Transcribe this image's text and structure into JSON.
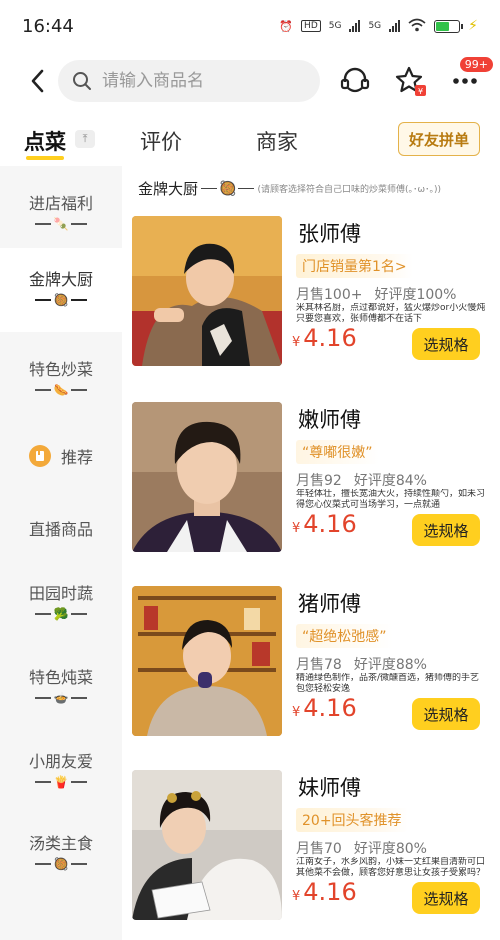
{
  "status_bar": {
    "time": "16:44",
    "hd": "HD",
    "net1": "5G",
    "net2": "5G"
  },
  "nav": {
    "search_placeholder": "请输入商品名",
    "more_badge": "99+"
  },
  "tabs": [
    {
      "label": "点菜",
      "active": true
    },
    {
      "label": "评价",
      "active": false
    },
    {
      "label": "商家",
      "active": false
    }
  ],
  "group_order_label": "好友拼单",
  "sidebar": [
    {
      "label": "进店福利",
      "deco": "🍡",
      "active": false
    },
    {
      "label": "金牌大厨",
      "deco": "🥘",
      "active": true
    },
    {
      "label": "特色炒菜",
      "deco": "🌭",
      "active": false
    },
    {
      "label": "推荐",
      "deco": "",
      "active": false
    },
    {
      "label": "直播商品",
      "deco": "",
      "active": false
    },
    {
      "label": "田园时蔬",
      "deco": "🥦",
      "active": false
    },
    {
      "label": "特色炖菜",
      "deco": "🍲",
      "active": false
    },
    {
      "label": "小朋友爱",
      "deco": "🍟",
      "active": false
    },
    {
      "label": "汤类主食",
      "deco": "🥘",
      "active": false
    }
  ],
  "section": {
    "title": "金牌大厨",
    "note": "(请顾客选择符合自己口味的炒菜师傅(｡･ω･｡))"
  },
  "chefs": [
    {
      "name": "张师傅",
      "tag": "门店销量第1名>",
      "sales": "月售100+",
      "rating": "好评度100%",
      "desc": "米其林名厨，点过都说好，猛火爆炒or小火慢炖只要您喜欢，张师傅都不在话下",
      "currency": "¥",
      "price": "4.16",
      "button": "选规格"
    },
    {
      "name": "嫩师傅",
      "tag": "“尊嘟很嫩”",
      "sales": "月售92",
      "rating": "好评度84%",
      "desc": "年轻体壮，擅长宽油大火，持续性颠勺，如未习得您心仪菜式可当场学习，一点就通",
      "currency": "¥",
      "price": "4.16",
      "button": "选规格"
    },
    {
      "name": "猪师傅",
      "tag": "“超绝松弛感”",
      "sales": "月售78",
      "rating": "好评度88%",
      "desc": "精通绿色制作，品茶/微醺首选，猪师傅的手艺包您轻松安逸",
      "currency": "¥",
      "price": "4.16",
      "button": "选规格"
    },
    {
      "name": "妹师傅",
      "tag": "20+回头客推荐",
      "sales": "月售70",
      "rating": "好评度80%",
      "desc": "江南女子，水乡风韵，小妹一丈红果自清新可口其他菜不会做，顾客您好意思让女孩子受累吗？",
      "currency": "¥",
      "price": "4.16",
      "button": "选规格"
    }
  ],
  "colors": {
    "accent": "#ffcf1f",
    "price": "#e2442b",
    "tag": "#e0922a",
    "badge": "#f04136"
  }
}
